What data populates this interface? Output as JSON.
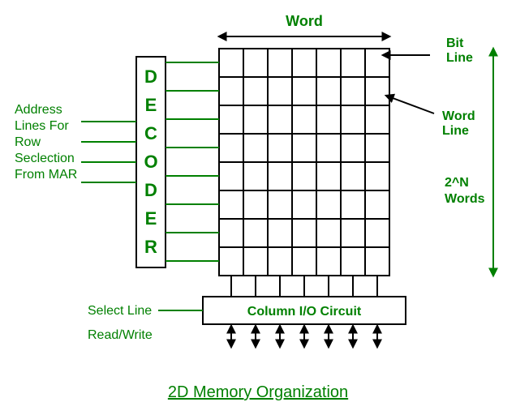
{
  "title": "2D Memory Organization",
  "labels": {
    "word": "Word",
    "bit_line": "Bit Line",
    "word_line": "Word Line",
    "two_n_words": "2^N Words",
    "decoder": "DECODER",
    "addr1": "Address",
    "addr2": "Lines For",
    "addr3": "Row",
    "addr4": "Seclection",
    "addr5": "From MAR",
    "select_line": "Select Line",
    "read_write": "Read/Write",
    "column_io": "Column I/O Circuit"
  },
  "chart_data": {
    "type": "diagram",
    "description": "2D memory organization block diagram",
    "blocks": [
      {
        "name": "Decoder",
        "vertical_text": "DECODER"
      },
      {
        "name": "Memory Cell Array",
        "rows": 8,
        "cols": 7
      },
      {
        "name": "Column I/O Circuit"
      }
    ],
    "connections": [
      {
        "name": "Address lines (row select) from MAR",
        "count": 4,
        "from": "external",
        "to": "Decoder",
        "color": "green"
      },
      {
        "name": "Word lines",
        "count": 8,
        "from": "Decoder",
        "to": "Memory Cell Array rows",
        "color": "green"
      },
      {
        "name": "Bit lines",
        "count": 7,
        "from": "Memory Cell Array columns",
        "to": "Column I/O Circuit",
        "color": "black"
      },
      {
        "name": "Select Line",
        "from": "external",
        "to": "Column I/O Circuit",
        "color": "green"
      },
      {
        "name": "Data I/O (bidirectional)",
        "count": 7,
        "from": "Column I/O Circuit",
        "to": "external",
        "color": "black"
      }
    ],
    "annotations": [
      {
        "label": "Word",
        "points_to": "memory array width"
      },
      {
        "label": "Bit Line",
        "points_to": "first column top"
      },
      {
        "label": "Word Line",
        "points_to": "row line"
      },
      {
        "label": "2^N Words",
        "points_to": "memory array height"
      },
      {
        "label": "Read/Write",
        "near": "Select Line"
      }
    ]
  }
}
